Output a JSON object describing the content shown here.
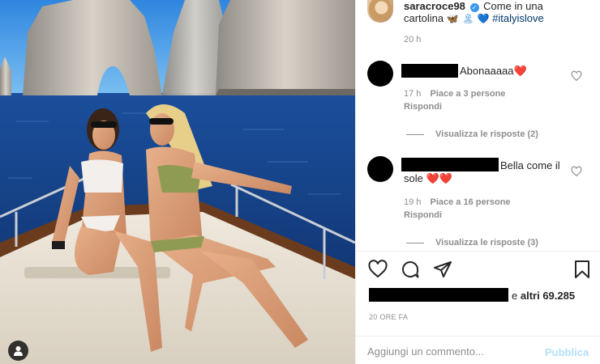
{
  "caption": {
    "username": "saracroce98",
    "verified_icon": "verified-badge-icon",
    "text_line1": "Come in una",
    "text_line2": "cartolina",
    "emojis": "🦋 🏝 💙",
    "hashtag": "#italyislove",
    "time": "20 h"
  },
  "comments": [
    {
      "text": "Abonaaaaa",
      "emoji": "❤️",
      "time": "17 h",
      "likes": "Piace a 3 persone",
      "reply": "Rispondi",
      "view_replies": "Visualizza le risposte (2)"
    },
    {
      "text": "Bella come il",
      "text_line2": "sole",
      "emoji": "❤️❤️",
      "time": "19 h",
      "likes": "Piace a 16 persone",
      "reply": "Rispondi",
      "view_replies": "Visualizza le risposte (3)"
    }
  ],
  "actions": {
    "icons": [
      "heart-icon",
      "comment-icon",
      "share-icon",
      "bookmark-icon"
    ],
    "likes_connector": "e",
    "likes_others": "altri 69.285",
    "date": "20 ORE FA"
  },
  "add_comment": {
    "placeholder": "Aggiungi un commento...",
    "publish": "Pubblica"
  },
  "colors": {
    "link": "#00376b",
    "verified": "#3897f0",
    "muted": "#8e8e8e",
    "publish_disabled": "#b2dffc",
    "heart": "#e0242f"
  }
}
